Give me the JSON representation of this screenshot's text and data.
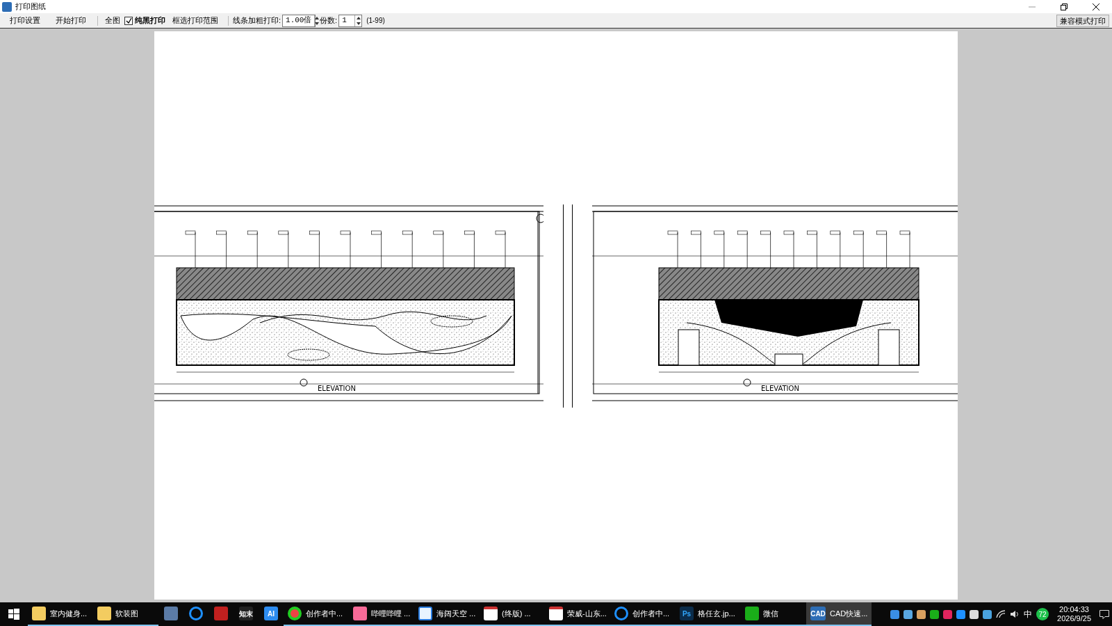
{
  "window": {
    "title": "打印图纸"
  },
  "toolbar": {
    "buttons": [
      "打印设置",
      "开始打印"
    ],
    "fit_button": "全图",
    "pure_black": {
      "label": "纯黑打印",
      "checked": true
    },
    "select_range": "框选打印范围",
    "line_weight": {
      "label": "线条加粗打印:",
      "value": "1.00倍"
    },
    "copies": {
      "label": "份数:",
      "value": "1",
      "range": "(1-99)"
    },
    "compat_button": "兼容模式打印"
  },
  "sheets": [
    {
      "title": "ELEVATION",
      "kind": "waves"
    },
    {
      "title": "ELEVATION",
      "kind": "forest"
    }
  ],
  "taskbar": {
    "items": [
      {
        "kind": "folder",
        "label": "室内健身...",
        "running": true,
        "selected": false
      },
      {
        "kind": "folder",
        "label": "软装图",
        "running": true,
        "selected": false
      },
      {
        "kind": "calculator",
        "running": false,
        "selected": false
      },
      {
        "kind": "qbrowser",
        "running": false,
        "selected": false
      },
      {
        "kind": "autocad",
        "running": false,
        "selected": false
      },
      {
        "kind": "textbox",
        "icon_text": "知末",
        "running": false,
        "selected": false
      },
      {
        "kind": "ai",
        "icon_text": "AI",
        "running": false,
        "selected": false
      },
      {
        "kind": "chrome",
        "label": "创作者中...",
        "running": true,
        "selected": false
      },
      {
        "kind": "bili",
        "label": "哔哩哔哩 ...",
        "running": true,
        "selected": false
      },
      {
        "kind": "sky",
        "label": "海阔天空 ...",
        "running": true,
        "selected": false
      },
      {
        "kind": "pdf",
        "label": "(终版) ...",
        "running": true,
        "selected": false
      },
      {
        "kind": "pdf",
        "label": "荣威-山东...",
        "running": true,
        "selected": false
      },
      {
        "kind": "qbrowser",
        "label": "创作者中...",
        "running": true,
        "selected": false
      },
      {
        "kind": "ps",
        "icon_text": "Ps",
        "label": "格任玄.jp...",
        "running": true,
        "selected": false
      },
      {
        "kind": "wechat",
        "label": "微信",
        "running": true,
        "selected": false
      },
      {
        "kind": "cad",
        "icon_text": "CAD",
        "label": "CAD快速...",
        "running": true,
        "selected": true
      }
    ],
    "tray": {
      "ime": "中",
      "badge": "72",
      "time": "20:04:33",
      "date": "2026/9/25"
    }
  }
}
